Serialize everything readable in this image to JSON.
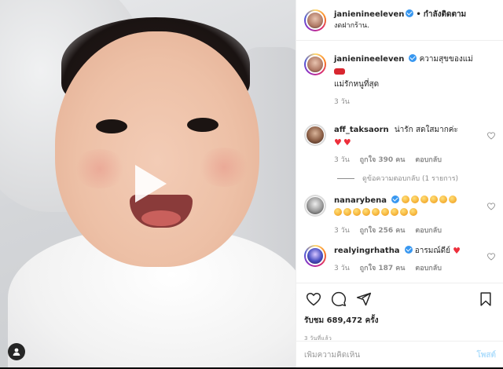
{
  "header": {
    "username": "janienineeleven",
    "separator": "•",
    "follow_label": "กำลังติดตาม",
    "location": "งดฝากร้าน."
  },
  "caption": {
    "username": "janienineeleven",
    "text_line1": "ความสุขของแม่",
    "text_line2": "แม่รักหนูที่สุด",
    "time": "3 วัน"
  },
  "comments": [
    {
      "username": "aff_taksaorn",
      "text": "น่ารัก สดใสมากค่ะ",
      "time": "3 วัน",
      "likes": "ถูกใจ 390 คน",
      "reply_label": "ตอบกลับ",
      "view_replies": "ดูข้อความตอบกลับ (1 รายการ)"
    },
    {
      "username": "nanarybena",
      "text": "",
      "time": "3 วัน",
      "likes": "ถูกใจ 256 คน",
      "reply_label": "ตอบกลับ"
    },
    {
      "username": "realyingrhatha",
      "text": "อารมณ์ดีย์",
      "time": "3 วัน",
      "likes": "ถูกใจ 187 คน",
      "reply_label": "ตอบกลับ"
    }
  ],
  "stats": {
    "views": "รับชม 689,472 ครั้ง",
    "posted": "3 วันที่แล้ว"
  },
  "add_comment": {
    "placeholder": "เพิ่มความคิดเห็น",
    "post_label": "โพสต์"
  },
  "icons": {
    "play": "play-icon",
    "user_tag": "user-tag-icon",
    "like": "heart-icon",
    "comment": "comment-icon",
    "share": "paper-plane-icon",
    "save": "bookmark-icon"
  },
  "colors": {
    "verified": "#3897f0",
    "heart": "#ed2f3b",
    "post_button_disabled": "#b2dffc"
  }
}
